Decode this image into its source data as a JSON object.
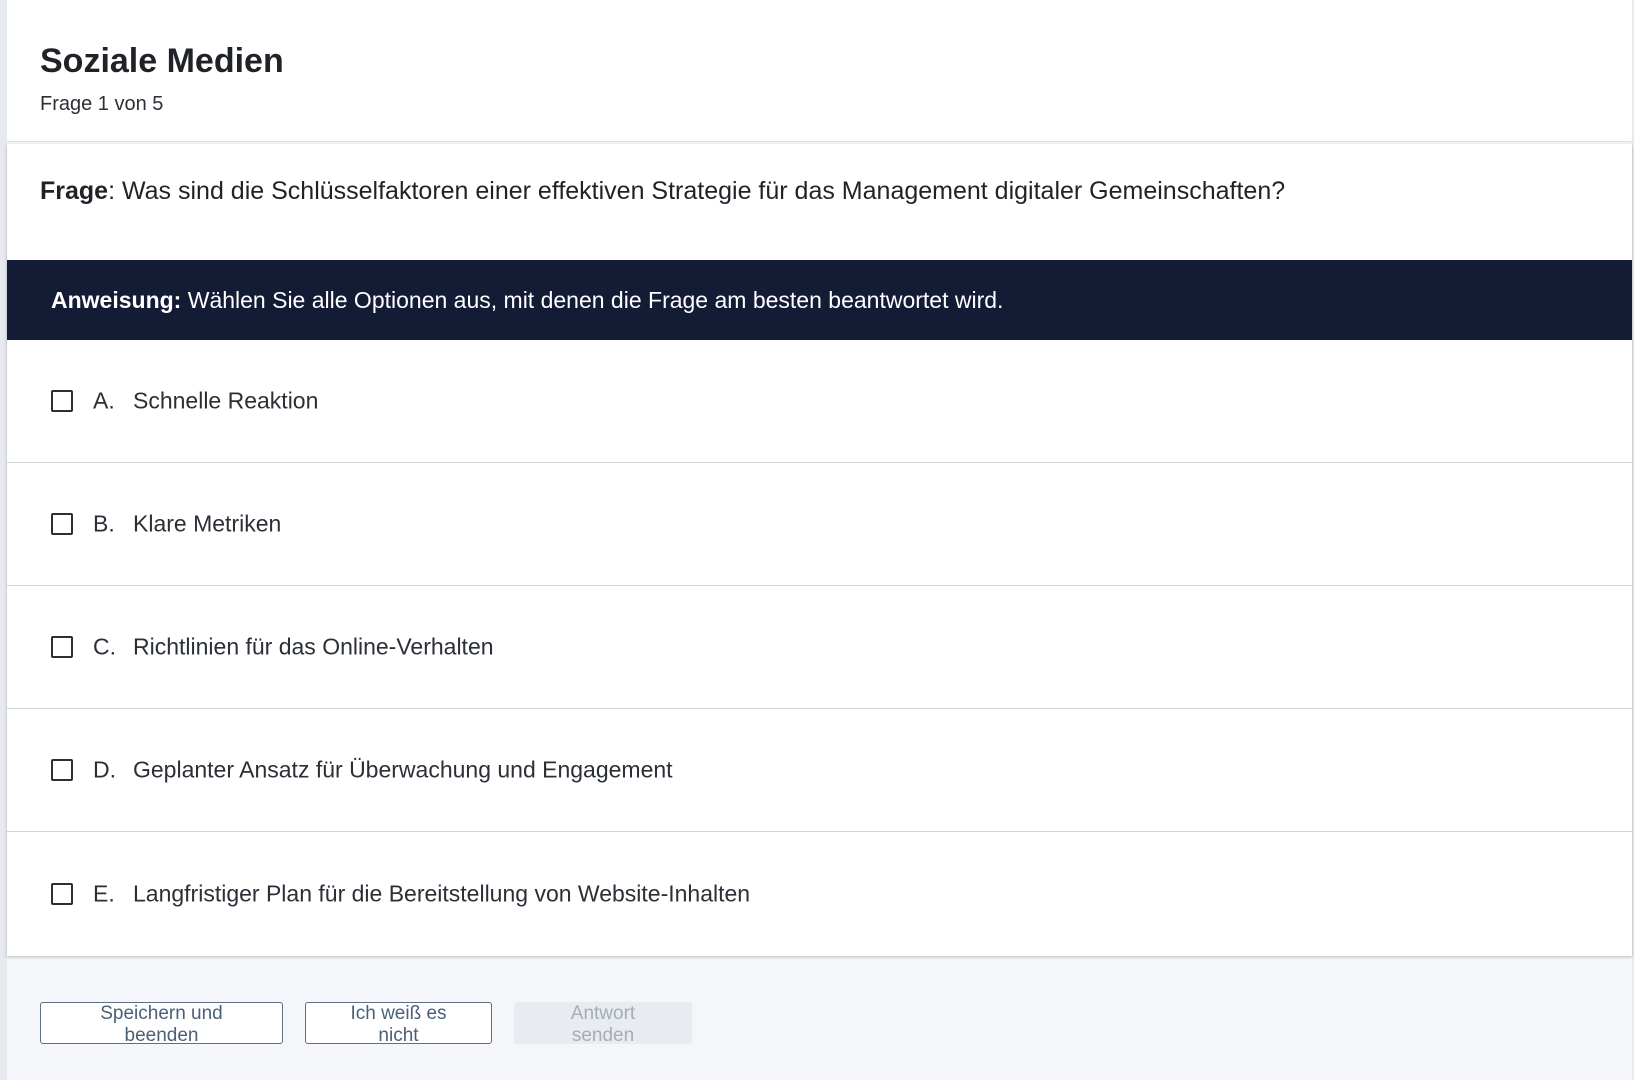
{
  "header": {
    "title": "Soziale Medien",
    "progress": "Frage 1 von 5"
  },
  "question": {
    "label": "Frage",
    "text": ": Was sind die Schlüsselfaktoren einer effektiven Strategie für das Management digitaler Gemeinschaften?"
  },
  "instruction": {
    "label": "Anweisung:",
    "text": " Wählen Sie alle Optionen aus, mit denen die Frage am besten beantwortet wird."
  },
  "options": [
    {
      "letter": "A.",
      "text": "Schnelle Reaktion",
      "checked": false
    },
    {
      "letter": "B.",
      "text": "Klare Metriken",
      "checked": false
    },
    {
      "letter": "C.",
      "text": "Richtlinien für das Online-Verhalten",
      "checked": false
    },
    {
      "letter": "D.",
      "text": "Geplanter Ansatz für Überwachung und Engagement",
      "checked": false
    },
    {
      "letter": "E.",
      "text": "Langfristiger Plan für die Bereitstellung von Website-Inhalten",
      "checked": false
    }
  ],
  "footer": {
    "save_label": "Speichern und beenden",
    "dunno_label": "Ich weiß es nicht",
    "submit_label": "Antwort senden"
  },
  "colors": {
    "instruction_bg": "#141b34",
    "button_border": "#5b6f86",
    "disabled_bg": "#e8ebef"
  }
}
